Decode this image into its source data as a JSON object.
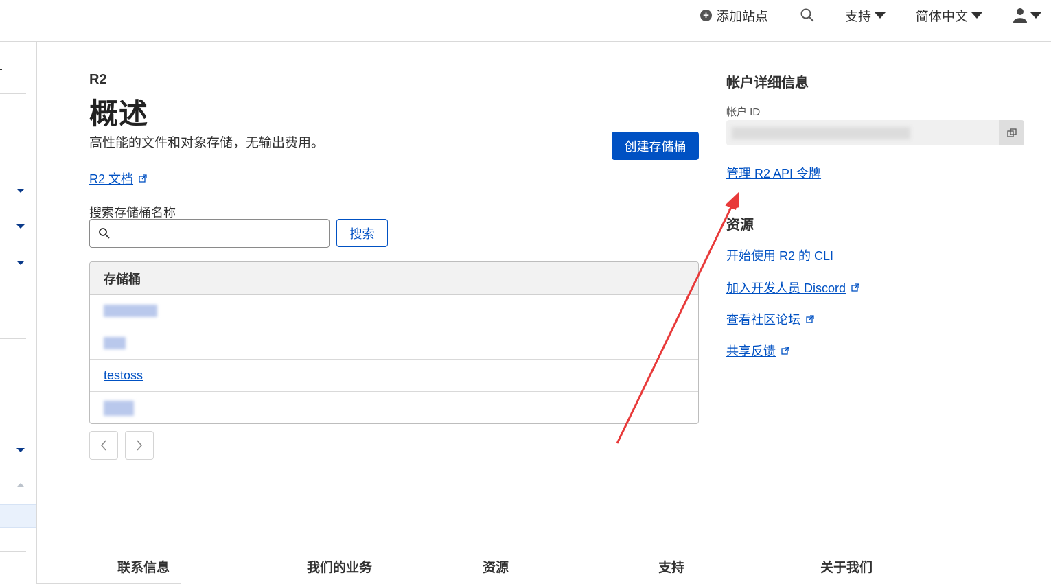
{
  "topbar": {
    "add_site": "添加站点",
    "support": "支持",
    "language": "简体中文"
  },
  "main": {
    "breadcrumb": "R2",
    "title": "概述",
    "subtitle": "高性能的文件和对象存储，无输出费用。",
    "create_button": "创建存储桶",
    "docs_link": "R2 文档",
    "search_label": "搜索存储桶名称",
    "search_value": "",
    "search_button": "搜索",
    "table": {
      "header": "存储桶",
      "rows": [
        "testoss"
      ]
    }
  },
  "account": {
    "title": "帐户详细信息",
    "id_label": "帐户 ID",
    "manage_link": "管理 R2 API 令牌"
  },
  "resources": {
    "title": "资源",
    "links": [
      "开始使用 R2 的 CLI",
      "加入开发人员 Discord",
      "查看社区论坛",
      "共享反馈"
    ]
  },
  "footer": {
    "columns": [
      "联系信息",
      "我们的业务",
      "资源",
      "支持",
      "关于我们"
    ]
  },
  "colors": {
    "accent": "#0051c3",
    "annotation": "#e83a3a"
  }
}
